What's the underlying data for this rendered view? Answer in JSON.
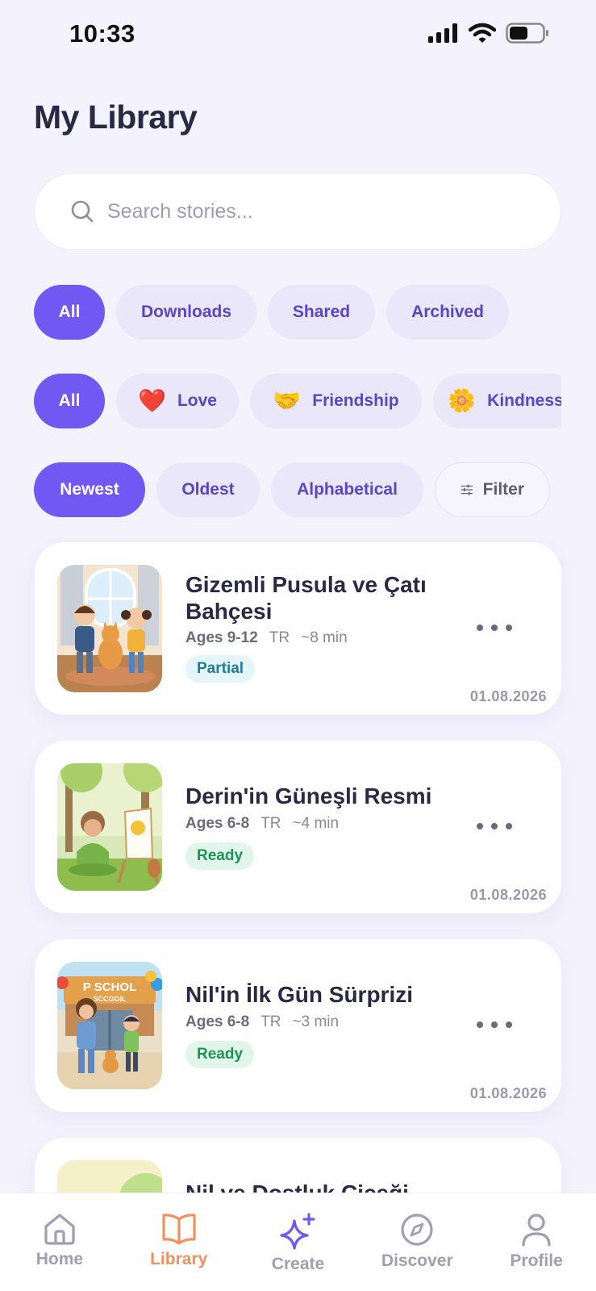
{
  "status_bar": {
    "time": "10:33"
  },
  "page": {
    "title": "My Library"
  },
  "search": {
    "placeholder": "Search stories..."
  },
  "filters_status": [
    "All",
    "Downloads",
    "Shared",
    "Archived"
  ],
  "filters_theme": [
    {
      "emoji": "❤️",
      "label": "Love"
    },
    {
      "emoji": "🤝",
      "label": "Friendship"
    },
    {
      "emoji": "🌼",
      "label": "Kindness"
    }
  ],
  "theme_all_label": "All",
  "sort_options": [
    "Newest",
    "Oldest",
    "Alphabetical"
  ],
  "filter_label": "Filter",
  "stories": [
    {
      "title": "Gizemli Pusula ve Çatı Bahçesi",
      "age": "Ages 9-12",
      "lang": "TR",
      "duration": "~8 min",
      "status": "Partial",
      "date": "01.08.2026"
    },
    {
      "title": "Derin'in Güneşli Resmi",
      "age": "Ages 6-8",
      "lang": "TR",
      "duration": "~4 min",
      "status": "Ready",
      "date": "01.08.2026"
    },
    {
      "title": "Nil'in İlk Gün Sürprizi",
      "age": "Ages 6-8",
      "lang": "TR",
      "duration": "~3 min",
      "status": "Ready",
      "date": "01.08.2026"
    },
    {
      "title": "Nil ve Dostluk Çiçeği"
    }
  ],
  "thumb_text": {
    "school_sign_1": "P SCHOL",
    "school_sign_2": "SCCOOIL"
  },
  "nav": [
    {
      "label": "Home",
      "icon": "home-icon"
    },
    {
      "label": "Library",
      "icon": "book-icon"
    },
    {
      "label": "Create",
      "icon": "sparkle-icon"
    },
    {
      "label": "Discover",
      "icon": "compass-icon"
    },
    {
      "label": "Profile",
      "icon": "person-icon"
    }
  ],
  "colors": {
    "accent": "#7258f2",
    "active_nav": "#f0915e",
    "background": "#f4f2fd"
  }
}
